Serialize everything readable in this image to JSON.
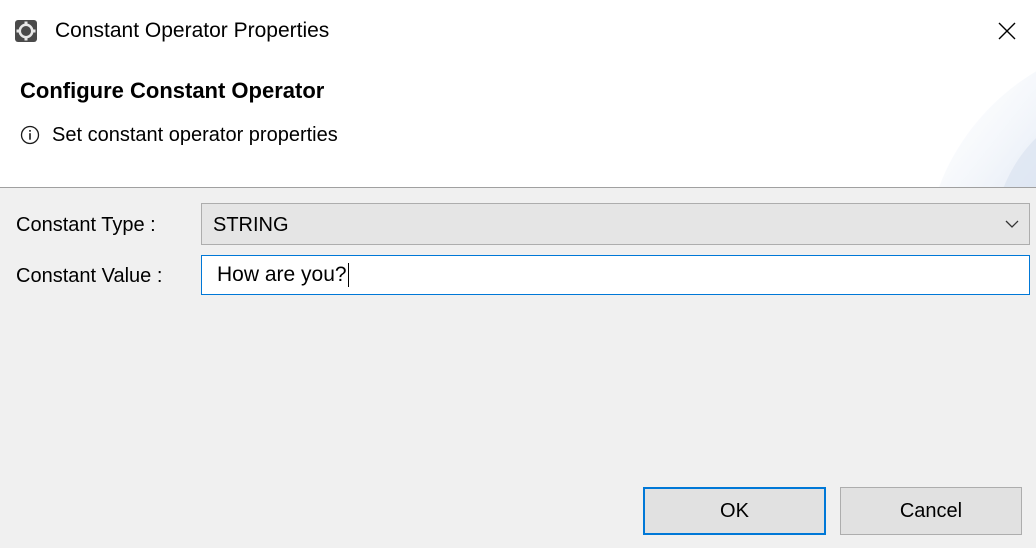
{
  "window": {
    "title": "Constant Operator Properties",
    "app_icon": "operator-gear-icon",
    "close_icon": "close-icon"
  },
  "banner": {
    "title": "Configure Constant Operator",
    "message": "Set constant operator properties",
    "message_icon": "info-icon"
  },
  "form": {
    "constant_type": {
      "label": "Constant Type :",
      "selected": "STRING",
      "icon": "chevron-down-icon"
    },
    "constant_value": {
      "label": "Constant Value :",
      "value": "How are you?"
    }
  },
  "buttons": {
    "ok": "OK",
    "cancel": "Cancel"
  },
  "colors": {
    "accent": "#0078d7",
    "dialog_bg": "#f0f0f0",
    "button_bg": "#e1e1e1",
    "select_bg": "#e5e5e5"
  }
}
